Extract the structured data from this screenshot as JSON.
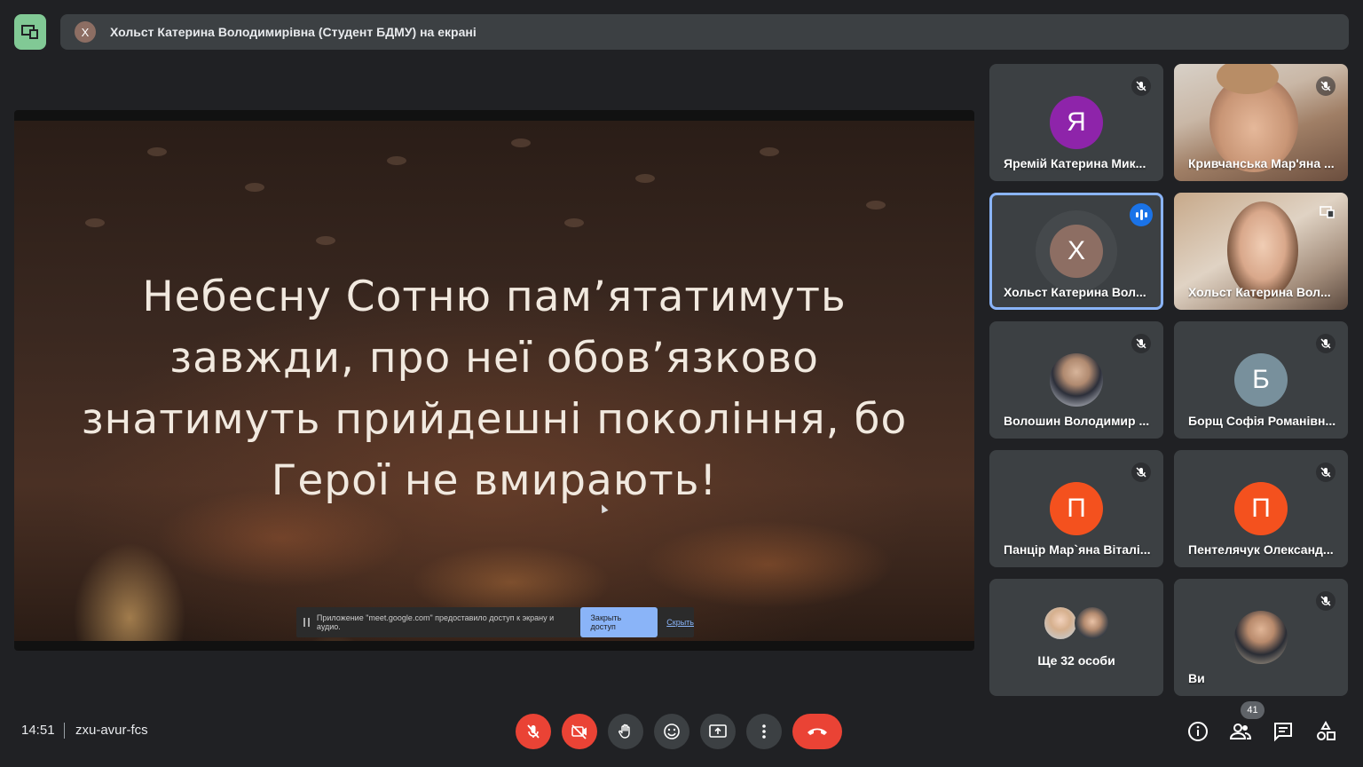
{
  "banner": {
    "avatar_letter": "Х",
    "text": "Хольст Катерина Володимирівна (Студент БДМУ) на екрані"
  },
  "slide": {
    "lines": [
      "Небесну Сотню пам’ятатимуть",
      "завжди, про неї обов’язково",
      "знатимуть прийдешні покоління, бо",
      "Герої не вмирають!"
    ],
    "share_notice": {
      "text": "Приложение \"meet.google.com\" предоставило доступ к экрану и аудио.",
      "stop_label": "Закрыть доступ",
      "hide_label": "Скрыть"
    }
  },
  "participants": [
    {
      "name": "Яремій Катерина Мик...",
      "letter": "Я",
      "color": "#8e24aa",
      "mic": "off"
    },
    {
      "name": "Кривчанська Мар'яна ...",
      "letter": "",
      "color": "",
      "mic": "off"
    },
    {
      "name": "Хольст Катерина Вол...",
      "letter": "Х",
      "color": "#8d6e63",
      "mic": "speaking"
    },
    {
      "name": "Хольст Катерина Вол...",
      "letter": "",
      "color": "",
      "mic": "presenting"
    },
    {
      "name": "Волошин Володимир ...",
      "letter": "",
      "color": "",
      "mic": "off"
    },
    {
      "name": "Борщ Софія Романівн...",
      "letter": "Б",
      "color": "#78909c",
      "mic": "off"
    },
    {
      "name": "Панцір Мар`яна Віталі...",
      "letter": "П",
      "color": "#f4511e",
      "mic": "off"
    },
    {
      "name": "Пентелячук Олександ...",
      "letter": "П",
      "color": "#f4511e",
      "mic": "off"
    },
    {
      "name": "Ви",
      "letter": "",
      "color": "",
      "mic": "off"
    }
  ],
  "more_participants": "Ще 32 особи",
  "bottom": {
    "time": "14:51",
    "meeting_code": "zxu-avur-fcs",
    "people_count": "41"
  },
  "colors": {
    "background": "#202124",
    "tile": "#3c4043",
    "danger": "#ea4335",
    "accent": "#8ab4f8",
    "present_green": "#81c995"
  }
}
